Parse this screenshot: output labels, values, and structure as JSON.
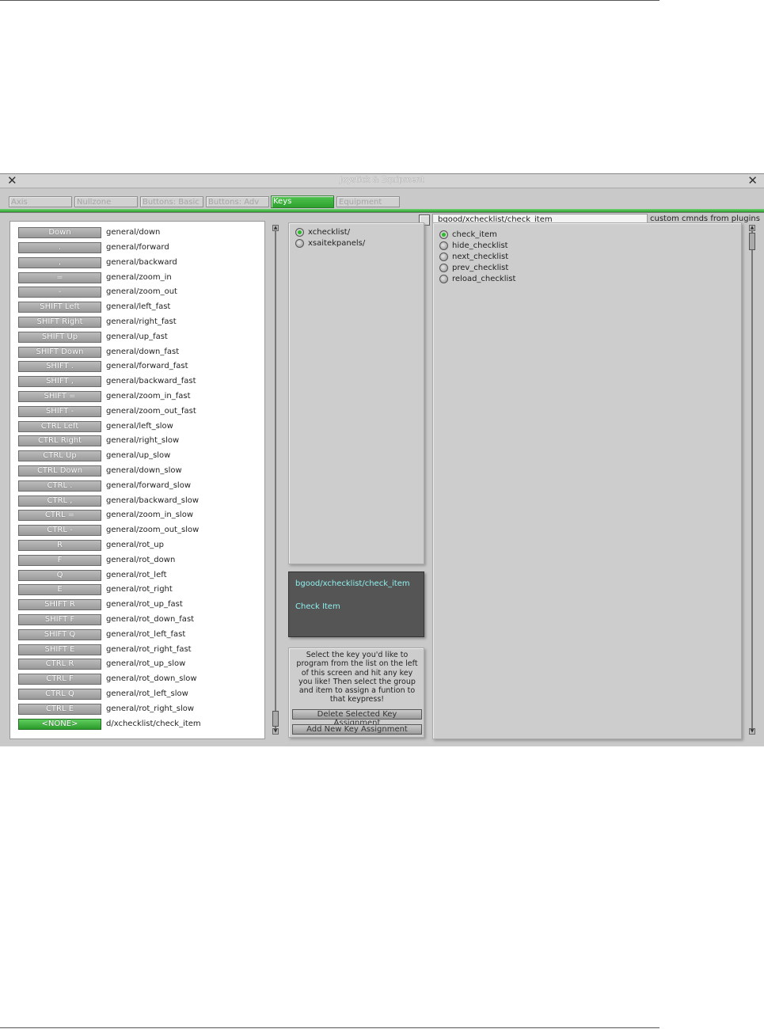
{
  "window": {
    "title": "Joystick & Equipment",
    "close_glyph": "✕"
  },
  "tabs": [
    {
      "label": "Axis",
      "active": false
    },
    {
      "label": "Nullzone",
      "active": false
    },
    {
      "label": "Buttons: Basic",
      "active": false
    },
    {
      "label": "Buttons: Adv",
      "active": false
    },
    {
      "label": "Keys",
      "active": true
    },
    {
      "label": "Equipment",
      "active": false
    }
  ],
  "command_filter": {
    "value": "bgood/xchecklist/check_item",
    "label": "custom cmnds from plugins"
  },
  "key_assignments": [
    {
      "key": "Down",
      "command": "general/down"
    },
    {
      "key": ".",
      "command": "general/forward"
    },
    {
      "key": ",",
      "command": "general/backward"
    },
    {
      "key": "=",
      "command": "general/zoom_in"
    },
    {
      "key": "-",
      "command": "general/zoom_out"
    },
    {
      "key": "SHIFT Left",
      "command": "general/left_fast"
    },
    {
      "key": "SHIFT Right",
      "command": "general/right_fast"
    },
    {
      "key": "SHIFT Up",
      "command": "general/up_fast"
    },
    {
      "key": "SHIFT Down",
      "command": "general/down_fast"
    },
    {
      "key": "SHIFT .",
      "command": "general/forward_fast"
    },
    {
      "key": "SHIFT ,",
      "command": "general/backward_fast"
    },
    {
      "key": "SHIFT =",
      "command": "general/zoom_in_fast"
    },
    {
      "key": "SHIFT -",
      "command": "general/zoom_out_fast"
    },
    {
      "key": "CTRL Left",
      "command": "general/left_slow"
    },
    {
      "key": "CTRL Right",
      "command": "general/right_slow"
    },
    {
      "key": "CTRL Up",
      "command": "general/up_slow"
    },
    {
      "key": "CTRL Down",
      "command": "general/down_slow"
    },
    {
      "key": "CTRL .",
      "command": "general/forward_slow"
    },
    {
      "key": "CTRL ,",
      "command": "general/backward_slow"
    },
    {
      "key": "CTRL =",
      "command": "general/zoom_in_slow"
    },
    {
      "key": "CTRL -",
      "command": "general/zoom_out_slow"
    },
    {
      "key": "R",
      "command": "general/rot_up"
    },
    {
      "key": "F",
      "command": "general/rot_down"
    },
    {
      "key": "Q",
      "command": "general/rot_left"
    },
    {
      "key": "E",
      "command": "general/rot_right"
    },
    {
      "key": "SHIFT R",
      "command": "general/rot_up_fast"
    },
    {
      "key": "SHIFT F",
      "command": "general/rot_down_fast"
    },
    {
      "key": "SHIFT Q",
      "command": "general/rot_left_fast"
    },
    {
      "key": "SHIFT E",
      "command": "general/rot_right_fast"
    },
    {
      "key": "CTRL R",
      "command": "general/rot_up_slow"
    },
    {
      "key": "CTRL F",
      "command": "general/rot_down_slow"
    },
    {
      "key": "CTRL Q",
      "command": "general/rot_left_slow"
    },
    {
      "key": "CTRL E",
      "command": "general/rot_right_slow"
    },
    {
      "key": "<NONE>",
      "command": "d/xchecklist/check_item",
      "selected": true
    }
  ],
  "groups": [
    {
      "label": "xchecklist/",
      "selected": true
    },
    {
      "label": "xsaitekpanels/",
      "selected": false
    }
  ],
  "items": [
    {
      "label": "check_item",
      "selected": true
    },
    {
      "label": "hide_checklist",
      "selected": false
    },
    {
      "label": "next_checklist",
      "selected": false
    },
    {
      "label": "prev_checklist",
      "selected": false
    },
    {
      "label": "reload_checklist",
      "selected": false
    }
  ],
  "info": {
    "command_path": "bgood/xchecklist/check_item",
    "description": "Check Item"
  },
  "help": {
    "text": "Select the key you'd like to program from the list on the left of this screen and hit any key you like! Then select the group and item to assign a funtion to that keypress!",
    "delete_label": "Delete Selected Key Assignment",
    "add_label": "Add New Key Assignment"
  }
}
